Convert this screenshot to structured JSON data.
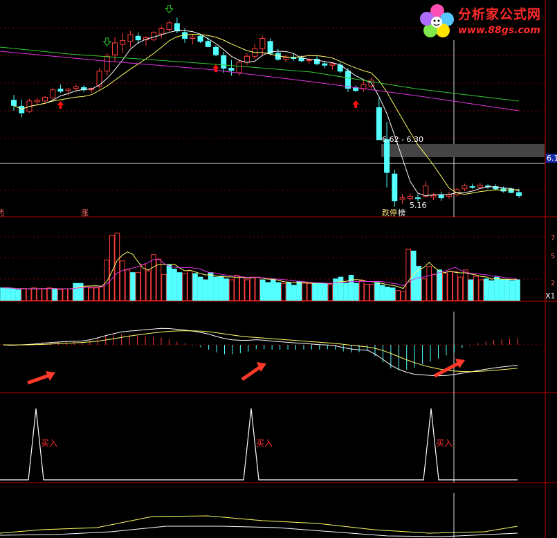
{
  "logo": {
    "title": "分析家公式网",
    "url": "www.88gs.com"
  },
  "colors": {
    "up": "#ff3c3c",
    "down": "#54ffff",
    "ma5": "#ffffff",
    "ma10": "#ffff66",
    "ma_green": "#33cc33",
    "ma_magenta": "#e033e0",
    "grid": "#8b0000",
    "separator": "#c00000",
    "buy_arrow": "#ff1010",
    "sell_arrow": "#33cc33",
    "highlight": "#444"
  },
  "chart_data": [
    {
      "type": "candlestick",
      "panel": "price",
      "candles": [
        [
          6.59,
          6.66,
          6.45,
          6.52
        ],
        [
          6.51,
          6.6,
          6.36,
          6.42
        ],
        [
          6.44,
          6.61,
          6.42,
          6.58
        ],
        [
          6.57,
          6.62,
          6.52,
          6.59
        ],
        [
          6.58,
          6.65,
          6.55,
          6.63
        ],
        [
          6.62,
          6.76,
          6.6,
          6.73
        ],
        [
          6.74,
          6.8,
          6.69,
          6.71
        ],
        [
          6.72,
          6.76,
          6.65,
          6.74
        ],
        [
          6.75,
          6.8,
          6.7,
          6.77
        ],
        [
          6.76,
          6.79,
          6.7,
          6.73
        ],
        [
          6.73,
          6.76,
          6.69,
          6.75
        ],
        [
          6.78,
          7.02,
          6.74,
          6.98
        ],
        [
          6.98,
          7.22,
          6.92,
          7.18
        ],
        [
          7.2,
          7.44,
          7.1,
          7.36
        ],
        [
          7.34,
          7.49,
          7.22,
          7.39
        ],
        [
          7.38,
          7.52,
          7.3,
          7.47
        ],
        [
          7.45,
          7.5,
          7.35,
          7.4
        ],
        [
          7.4,
          7.45,
          7.32,
          7.43
        ],
        [
          7.4,
          7.52,
          7.38,
          7.5
        ],
        [
          7.48,
          7.58,
          7.42,
          7.55
        ],
        [
          7.54,
          7.66,
          7.5,
          7.63
        ],
        [
          7.62,
          7.7,
          7.49,
          7.52
        ],
        [
          7.5,
          7.56,
          7.36,
          7.42
        ],
        [
          7.42,
          7.48,
          7.34,
          7.44
        ],
        [
          7.45,
          7.48,
          7.36,
          7.38
        ],
        [
          7.38,
          7.44,
          7.3,
          7.31
        ],
        [
          7.3,
          7.33,
          7.18,
          7.2
        ],
        [
          7.19,
          7.24,
          6.96,
          7.02
        ],
        [
          7.02,
          7.13,
          6.92,
          6.99
        ],
        [
          6.96,
          7.14,
          6.92,
          7.1
        ],
        [
          7.1,
          7.22,
          7.06,
          7.18
        ],
        [
          7.18,
          7.34,
          7.14,
          7.28
        ],
        [
          7.28,
          7.45,
          7.2,
          7.42
        ],
        [
          7.38,
          7.42,
          7.2,
          7.22
        ],
        [
          7.22,
          7.28,
          7.12,
          7.14
        ],
        [
          7.14,
          7.2,
          7.1,
          7.16
        ],
        [
          7.16,
          7.22,
          7.12,
          7.15
        ],
        [
          7.16,
          7.19,
          7.1,
          7.12
        ],
        [
          7.12,
          7.16,
          7.08,
          7.13
        ],
        [
          7.14,
          7.18,
          7.06,
          7.08
        ],
        [
          7.08,
          7.12,
          7.02,
          7.06
        ],
        [
          7.06,
          7.1,
          7.0,
          7.08
        ],
        [
          7.06,
          7.1,
          6.95,
          6.98
        ],
        [
          6.98,
          7.02,
          6.7,
          6.75
        ],
        [
          6.76,
          6.79,
          6.7,
          6.72
        ],
        [
          6.74,
          6.86,
          6.7,
          6.8
        ],
        [
          6.78,
          6.9,
          6.75,
          6.86
        ],
        [
          6.49,
          6.62,
          6.06,
          6.06
        ],
        [
          6.06,
          6.3,
          5.42,
          5.62
        ],
        [
          5.6,
          5.66,
          5.16,
          5.24
        ],
        [
          5.26,
          5.33,
          5.2,
          5.28
        ],
        [
          5.27,
          5.34,
          5.24,
          5.3
        ],
        [
          5.28,
          5.33,
          5.23,
          5.27
        ],
        [
          5.3,
          5.5,
          5.28,
          5.44
        ],
        [
          5.29,
          5.34,
          5.25,
          5.31
        ],
        [
          5.32,
          5.36,
          5.24,
          5.28
        ],
        [
          5.3,
          5.36,
          5.27,
          5.32
        ],
        [
          5.32,
          5.41,
          5.3,
          5.39
        ],
        [
          5.4,
          5.47,
          5.37,
          5.44
        ],
        [
          5.43,
          5.47,
          5.4,
          5.42
        ],
        [
          5.42,
          5.48,
          5.4,
          5.45
        ],
        [
          5.44,
          5.46,
          5.4,
          5.43
        ],
        [
          5.43,
          5.46,
          5.38,
          5.4
        ],
        [
          5.4,
          5.43,
          5.35,
          5.37
        ],
        [
          5.4,
          5.42,
          5.34,
          5.35
        ],
        [
          5.35,
          5.4,
          5.28,
          5.31
        ]
      ],
      "annotations": {
        "range_label": "6.62 - 6.30",
        "low_label": "5.16",
        "right_price": "6.1",
        "text_left": "涨",
        "text_bottom": "跌停",
        "text_bottom2": "榜",
        "text_clip": "药"
      },
      "buy_arrows": [
        6,
        26,
        44
      ],
      "sell_arrows": [
        12,
        20
      ]
    },
    {
      "type": "bar",
      "panel": "volume",
      "values": [
        1.4,
        1.4,
        1.3,
        1.2,
        1.3,
        1.3,
        1.4,
        1.3,
        1.3,
        1.4,
        1.3,
        1.2,
        1.3,
        1.3,
        1.9,
        1.9,
        1.6,
        1.4,
        1.4,
        1.6,
        4.5,
        7.2,
        7.5,
        4.4,
        3.4,
        3.1,
        3.1,
        4.0,
        3.3,
        5.1,
        4.6,
        2.9,
        4.0,
        3.5,
        3.1,
        3.0,
        3.3,
        3.0,
        2.6,
        2.3,
        3.1,
        2.6,
        2.7,
        2.4,
        2.3,
        2.8,
        2.6,
        2.3,
        2.6,
        2.6,
        2.3,
        2.0,
        2.3,
        2.0,
        1.9,
        2.0,
        1.7,
        2.1,
        2.0,
        1.9,
        1.9,
        1.9,
        1.9,
        1.8,
        2.4,
        2.6,
        1.9,
        2.8,
        1.9,
        2.2,
        1.8,
        1.8,
        2.0,
        1.7,
        1.5,
        1.4,
        1.1,
        1.0,
        5.7,
        5.5,
        3.8,
        2.4,
        3.8,
        2.9,
        3.4,
        3.0,
        3.2,
        3.2,
        2.6,
        3.4,
        2.3,
        2.7,
        2.3,
        2.4,
        2.2,
        2.6,
        2.3,
        2.3,
        2.2,
        2.3
      ],
      "scale_labels": [
        "7",
        "5",
        "2"
      ],
      "scale_values": [
        7,
        5,
        2
      ],
      "corner_label": "X1"
    },
    {
      "type": "macd",
      "panel": "macd",
      "arrows": 3
    },
    {
      "type": "line",
      "panel": "signal",
      "peaks_label": "买入",
      "peaks": [
        52,
        363,
        623
      ]
    }
  ]
}
